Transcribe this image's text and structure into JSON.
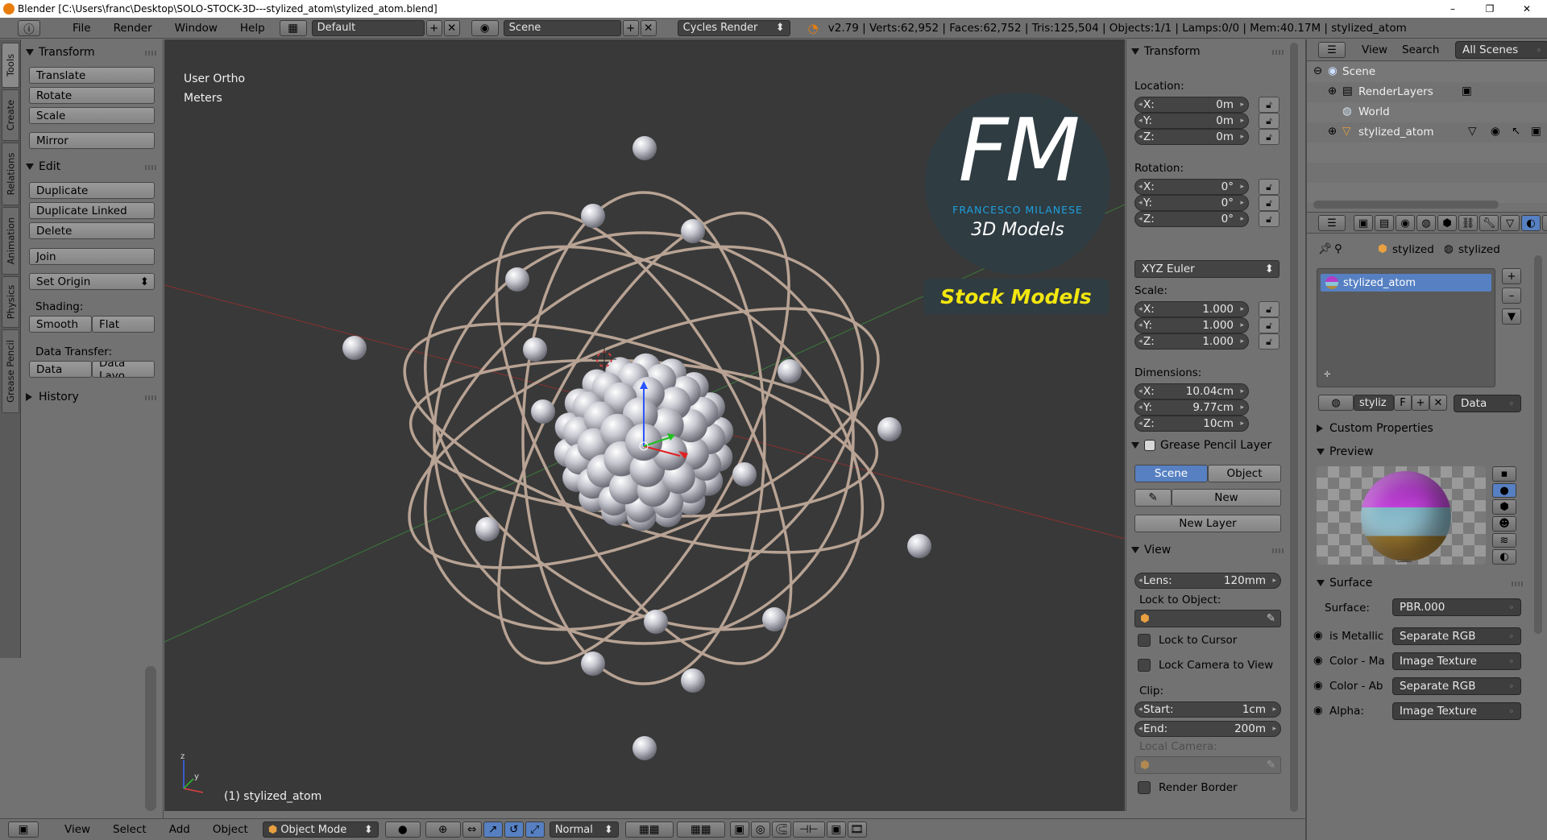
{
  "window": {
    "title": "Blender [C:\\Users\\franc\\Desktop\\SOLO-STOCK-3D---stylized_atom\\stylized_atom.blend]",
    "minimize": "–",
    "maximize": "❐",
    "close": "✕"
  },
  "menubar": {
    "menus": [
      "File",
      "Render",
      "Window",
      "Help"
    ],
    "screen_layout": "Default",
    "scene": "Scene",
    "render_engine": "Cycles Render",
    "status": "v2.79 | Verts:62,952 | Faces:62,752 | Tris:125,504 | Objects:1/1 | Lamps:0/0 | Mem:40.17M | stylized_atom"
  },
  "toolshelf": {
    "tabs": [
      "Tools",
      "Create",
      "Relations",
      "Animation",
      "Physics",
      "Grease Pencil"
    ],
    "transform": {
      "header": "Transform",
      "buttons": [
        "Translate",
        "Rotate",
        "Scale",
        "Mirror"
      ]
    },
    "edit": {
      "header": "Edit",
      "buttons": [
        "Duplicate",
        "Duplicate Linked",
        "Delete",
        "Join"
      ],
      "set_origin": "Set Origin",
      "shading_label": "Shading:",
      "smooth": "Smooth",
      "flat": "Flat",
      "data_transfer_label": "Data Transfer:",
      "data": "Data",
      "data_layout": "Data Layo"
    },
    "history": {
      "header": "History"
    }
  },
  "viewport": {
    "view_name": "User Ortho",
    "units": "Meters",
    "object_label": "(1) stylized_atom",
    "watermark": {
      "letters": "FM",
      "brand": "FRANCESCO MILANESE",
      "tagline": "3D Models",
      "banner": "Stock Models"
    }
  },
  "npanel": {
    "transform": {
      "header": "Transform",
      "location_label": "Location:",
      "location": [
        {
          "axis": "X:",
          "value": "0m"
        },
        {
          "axis": "Y:",
          "value": "0m"
        },
        {
          "axis": "Z:",
          "value": "0m"
        }
      ],
      "rotation_label": "Rotation:",
      "rotation": [
        {
          "axis": "X:",
          "value": "0°"
        },
        {
          "axis": "Y:",
          "value": "0°"
        },
        {
          "axis": "Z:",
          "value": "0°"
        }
      ],
      "rotation_mode": "XYZ Euler",
      "scale_label": "Scale:",
      "scale": [
        {
          "axis": "X:",
          "value": "1.000"
        },
        {
          "axis": "Y:",
          "value": "1.000"
        },
        {
          "axis": "Z:",
          "value": "1.000"
        }
      ],
      "dimensions_label": "Dimensions:",
      "dimensions": [
        {
          "axis": "X:",
          "value": "10.04cm"
        },
        {
          "axis": "Y:",
          "value": "9.77cm"
        },
        {
          "axis": "Z:",
          "value": "10cm"
        }
      ]
    },
    "grease_pencil": {
      "header": "Grease Pencil Layer",
      "scene_tab": "Scene",
      "object_tab": "Object",
      "new": "New",
      "new_layer": "New Layer"
    },
    "view": {
      "header": "View",
      "lens_label": "Lens:",
      "lens_value": "120mm",
      "lock_to_object": "Lock to Object:",
      "lock_to_cursor": "Lock to Cursor",
      "lock_camera": "Lock Camera to View",
      "clip_label": "Clip:",
      "clip_start_label": "Start:",
      "clip_start": "1cm",
      "clip_end_label": "End:",
      "clip_end": "200m",
      "local_camera": "Local Camera:",
      "render_border": "Render Border"
    }
  },
  "outliner": {
    "view": "View",
    "search": "Search",
    "filter": "All Scenes",
    "items": [
      "Scene",
      "RenderLayers",
      "World",
      "stylized_atom"
    ]
  },
  "properties": {
    "breadcrumb": [
      "stylized",
      "stylized"
    ],
    "material_slot": "stylized_atom",
    "material_name": "styliz",
    "fake_user": "F",
    "data_link": "Data",
    "custom_properties": "Custom Properties",
    "preview": "Preview",
    "surface": {
      "header": "Surface",
      "surface_label": "Surface:",
      "surface_value": "PBR.000",
      "inputs": [
        {
          "label": "is Metallic",
          "value": "Separate RGB"
        },
        {
          "label": "Color - Ma",
          "value": "Image Texture"
        },
        {
          "label": "Color - Ab",
          "value": "Separate RGB"
        },
        {
          "label": "Alpha:",
          "value": "Image Texture"
        }
      ]
    }
  },
  "bottombar": {
    "view": "View",
    "select": "Select",
    "add": "Add",
    "object": "Object",
    "mode": "Object Mode",
    "orientation": "Normal"
  },
  "colors": {
    "selection_blue": "#5680c2",
    "accent_orange": "#e87d0d",
    "watermark_blue": "#1ea0de",
    "banner_yellow": "#f2e60f"
  }
}
